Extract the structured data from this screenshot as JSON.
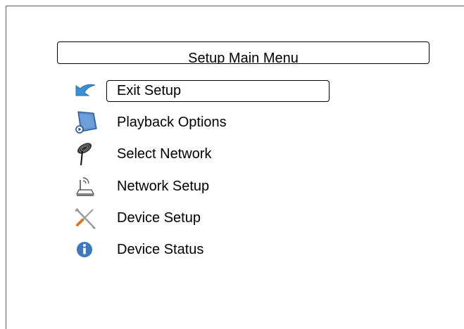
{
  "menu": {
    "title": "Setup Main Menu",
    "items": [
      {
        "label": "Exit Setup",
        "icon": "back-arrow-icon",
        "selected": true
      },
      {
        "label": "Playback Options",
        "icon": "playback-options-icon",
        "selected": false
      },
      {
        "label": "Select Network",
        "icon": "antenna-icon",
        "selected": false
      },
      {
        "label": "Network Setup",
        "icon": "router-icon",
        "selected": false
      },
      {
        "label": "Device Setup",
        "icon": "tools-icon",
        "selected": false
      },
      {
        "label": "Device Status",
        "icon": "info-icon",
        "selected": false
      }
    ]
  },
  "colors": {
    "accent_blue": "#3b78bf",
    "frame_border": "#5a5a5a",
    "text": "#000000"
  }
}
